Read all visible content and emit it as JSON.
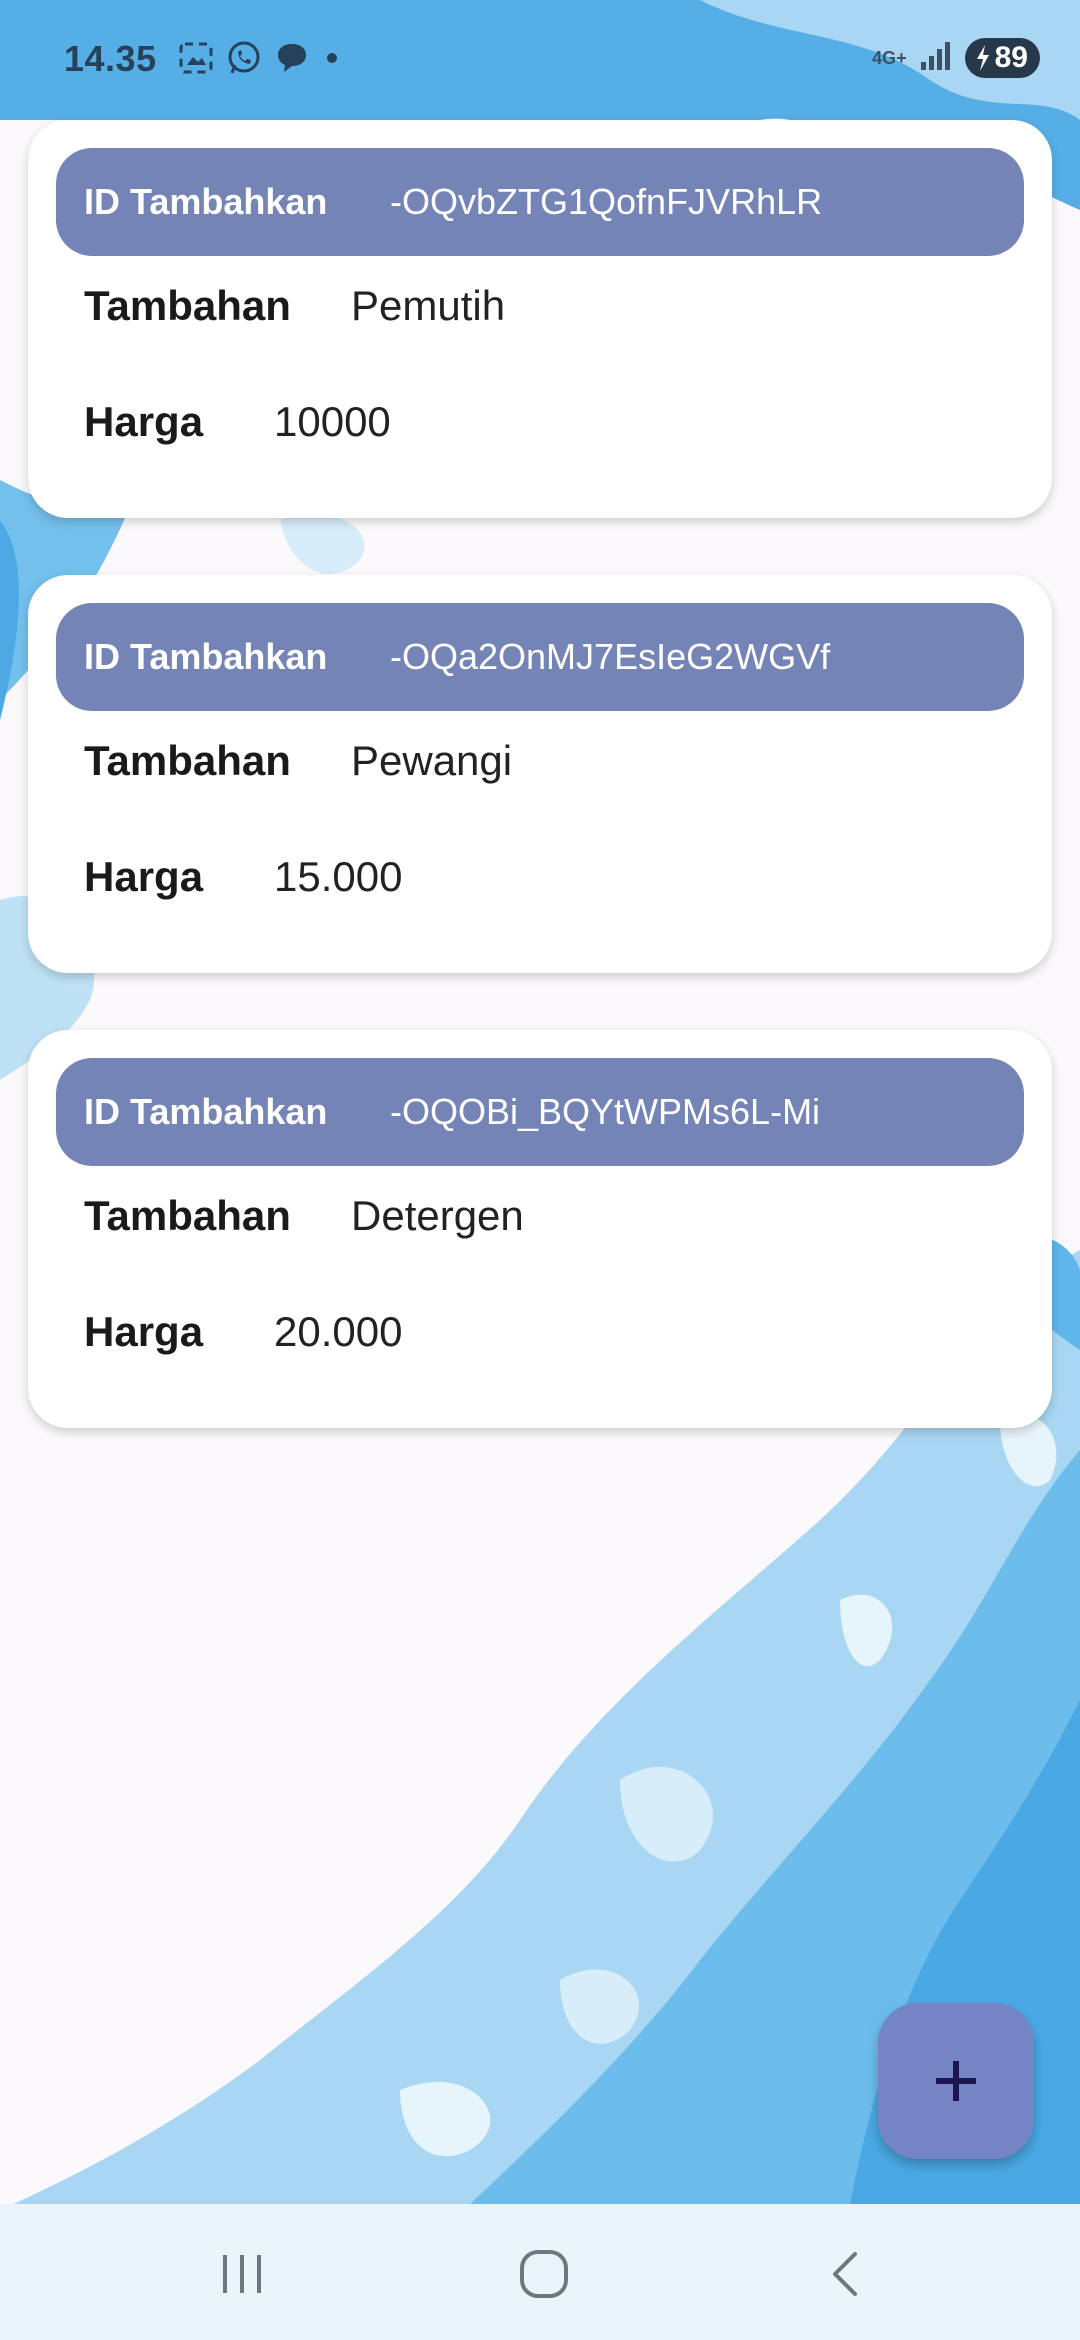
{
  "status_bar": {
    "time": "14.35",
    "left_icons": [
      "screenshot-icon",
      "whatsapp-icon",
      "chat-bubble-icon",
      "dot-icon"
    ],
    "network": "4G+",
    "battery_level": "89"
  },
  "items": [
    {
      "id_label": "ID Tambahkan",
      "id_value": "-OQvbZTG1QofnFJVRhLR",
      "tambahan_label": "Tambahan",
      "tambahan_value": "Pemutih",
      "harga_label": "Harga",
      "harga_value": "10000"
    },
    {
      "id_label": "ID Tambahkan",
      "id_value": "-OQa2OnMJ7EsIeG2WGVf",
      "tambahan_label": "Tambahan",
      "tambahan_value": "Pewangi",
      "harga_label": "Harga",
      "harga_value": "15.000"
    },
    {
      "id_label": "ID Tambahkan",
      "id_value": "-OQOBi_BQYtWPMs6L-Mi",
      "tambahan_label": "Tambahan",
      "tambahan_value": "Detergen",
      "harga_label": "Harga",
      "harga_value": "20.000"
    }
  ],
  "fab": {
    "icon": "plus-icon"
  },
  "nav_bar": {
    "buttons": [
      "recent-apps-icon",
      "home-icon",
      "back-icon"
    ]
  },
  "colors": {
    "header": "#7484b6",
    "fab": "#7484c4",
    "background": "#fbf9fc",
    "water": "#5eb6ea"
  }
}
